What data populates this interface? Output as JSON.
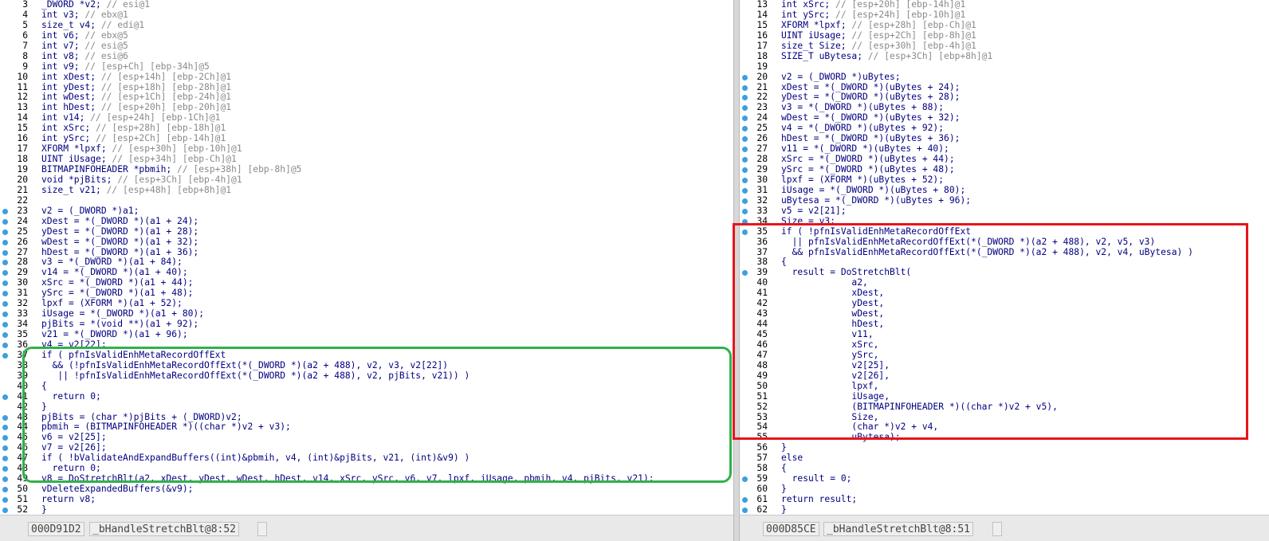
{
  "left_pane": {
    "status": {
      "address": "000D91D2",
      "function": "_bHandleStretchBlt@8:52"
    },
    "lines": [
      {
        "num": "3",
        "bp": false,
        "code": "_DWORD *v2; ",
        "comment": "// esi@1"
      },
      {
        "num": "4",
        "bp": false,
        "code": "int v3; ",
        "comment": "// ebx@1"
      },
      {
        "num": "5",
        "bp": false,
        "code": "size_t v4; ",
        "comment": "// edi@1"
      },
      {
        "num": "6",
        "bp": false,
        "code": "int v6; ",
        "comment": "// ebx@5"
      },
      {
        "num": "7",
        "bp": false,
        "code": "int v7; ",
        "comment": "// esi@5"
      },
      {
        "num": "8",
        "bp": false,
        "code": "int v8; ",
        "comment": "// esi@6"
      },
      {
        "num": "9",
        "bp": false,
        "code": "int v9; ",
        "comment": "// [esp+Ch] [ebp-34h]@5"
      },
      {
        "num": "10",
        "bp": false,
        "code": "int xDest; ",
        "comment": "// [esp+14h] [ebp-2Ch]@1"
      },
      {
        "num": "11",
        "bp": false,
        "code": "int yDest; ",
        "comment": "// [esp+18h] [ebp-28h]@1"
      },
      {
        "num": "12",
        "bp": false,
        "code": "int wDest; ",
        "comment": "// [esp+1Ch] [ebp-24h]@1"
      },
      {
        "num": "13",
        "bp": false,
        "code": "int hDest; ",
        "comment": "// [esp+20h] [ebp-20h]@1"
      },
      {
        "num": "14",
        "bp": false,
        "code": "int v14; ",
        "comment": "// [esp+24h] [ebp-1Ch]@1"
      },
      {
        "num": "15",
        "bp": false,
        "code": "int xSrc; ",
        "comment": "// [esp+28h] [ebp-18h]@1"
      },
      {
        "num": "16",
        "bp": false,
        "code": "int ySrc; ",
        "comment": "// [esp+2Ch] [ebp-14h]@1"
      },
      {
        "num": "17",
        "bp": false,
        "code": "XFORM *lpxf; ",
        "comment": "// [esp+30h] [ebp-10h]@1"
      },
      {
        "num": "18",
        "bp": false,
        "code": "UINT iUsage; ",
        "comment": "// [esp+34h] [ebp-Ch]@1"
      },
      {
        "num": "19",
        "bp": false,
        "code": "BITMAPINFOHEADER *pbmih; ",
        "comment": "// [esp+38h] [ebp-8h]@5"
      },
      {
        "num": "20",
        "bp": false,
        "code": "void *pjBits; ",
        "comment": "// [esp+3Ch] [ebp-4h]@1"
      },
      {
        "num": "21",
        "bp": false,
        "code": "size_t v21; ",
        "comment": "// [esp+48h] [ebp+8h]@1"
      },
      {
        "num": "22",
        "bp": false,
        "code": "",
        "comment": ""
      },
      {
        "num": "23",
        "bp": true,
        "code": "v2 = (_DWORD *)a1;",
        "comment": ""
      },
      {
        "num": "24",
        "bp": true,
        "code": "xDest = *(_DWORD *)(a1 + 24);",
        "comment": ""
      },
      {
        "num": "25",
        "bp": true,
        "code": "yDest = *(_DWORD *)(a1 + 28);",
        "comment": ""
      },
      {
        "num": "26",
        "bp": true,
        "code": "wDest = *(_DWORD *)(a1 + 32);",
        "comment": ""
      },
      {
        "num": "27",
        "bp": true,
        "code": "hDest = *(_DWORD *)(a1 + 36);",
        "comment": ""
      },
      {
        "num": "28",
        "bp": true,
        "code": "v3 = *(_DWORD *)(a1 + 84);",
        "comment": ""
      },
      {
        "num": "29",
        "bp": true,
        "code": "v14 = *(_DWORD *)(a1 + 40);",
        "comment": ""
      },
      {
        "num": "30",
        "bp": true,
        "code": "xSrc = *(_DWORD *)(a1 + 44);",
        "comment": ""
      },
      {
        "num": "31",
        "bp": true,
        "code": "ySrc = *(_DWORD *)(a1 + 48);",
        "comment": ""
      },
      {
        "num": "32",
        "bp": true,
        "code": "lpxf = (XFORM *)(a1 + 52);",
        "comment": ""
      },
      {
        "num": "33",
        "bp": true,
        "code": "iUsage = *(_DWORD *)(a1 + 80);",
        "comment": ""
      },
      {
        "num": "34",
        "bp": true,
        "code": "pjBits = *(void **)(a1 + 92);",
        "comment": ""
      },
      {
        "num": "35",
        "bp": true,
        "code": "v21 = *(_DWORD *)(a1 + 96);",
        "comment": ""
      },
      {
        "num": "36",
        "bp": true,
        "code": "v4 = v2[22];",
        "comment": ""
      },
      {
        "num": "37",
        "bp": true,
        "code": "if ( pfnIsValidEnhMetaRecordOffExt",
        "comment": ""
      },
      {
        "num": "38",
        "bp": false,
        "code": "  && (!pfnIsValidEnhMetaRecordOffExt(*(_DWORD *)(a2 + 488), v2, v3, v2[22])",
        "comment": ""
      },
      {
        "num": "39",
        "bp": false,
        "code": "   || !pfnIsValidEnhMetaRecordOffExt(*(_DWORD *)(a2 + 488), v2, pjBits, v21)) )",
        "comment": ""
      },
      {
        "num": "40",
        "bp": false,
        "code": "{",
        "comment": ""
      },
      {
        "num": "41",
        "bp": true,
        "code": "  return 0;",
        "comment": ""
      },
      {
        "num": "42",
        "bp": false,
        "code": "}",
        "comment": ""
      },
      {
        "num": "43",
        "bp": true,
        "code": "pjBits = (char *)pjBits + (_DWORD)v2;",
        "comment": ""
      },
      {
        "num": "44",
        "bp": true,
        "code": "pbmih = (BITMAPINFOHEADER *)((char *)v2 + v3);",
        "comment": ""
      },
      {
        "num": "45",
        "bp": true,
        "code": "v6 = v2[25];",
        "comment": ""
      },
      {
        "num": "46",
        "bp": true,
        "code": "v7 = v2[26];",
        "comment": ""
      },
      {
        "num": "47",
        "bp": true,
        "code": "if ( !bValidateAndExpandBuffers((int)&pbmih, v4, (int)&pjBits, v21, (int)&v9) )",
        "comment": ""
      },
      {
        "num": "48",
        "bp": true,
        "code": "  return 0;",
        "comment": ""
      },
      {
        "num": "49",
        "bp": true,
        "code": "v8 = DoStretchBlt(a2, xDest, yDest, wDest, hDest, v14, xSrc, ySrc, v6, v7, lpxf, iUsage, pbmih, v4, pjBits, v21);",
        "comment": ""
      },
      {
        "num": "50",
        "bp": true,
        "code": "vDeleteExpandedBuffers(&v9);",
        "comment": ""
      },
      {
        "num": "51",
        "bp": true,
        "code": "return v8;",
        "comment": ""
      },
      {
        "num": "52",
        "bp": true,
        "code": "}",
        "comment": ""
      }
    ]
  },
  "right_pane": {
    "status": {
      "address": "000D85CE",
      "function": "_bHandleStretchBlt@8:51"
    },
    "lines": [
      {
        "num": "13",
        "bp": false,
        "code": "int xSrc; ",
        "comment": "// [esp+20h] [ebp-14h]@1"
      },
      {
        "num": "14",
        "bp": false,
        "code": "int ySrc; ",
        "comment": "// [esp+24h] [ebp-10h]@1"
      },
      {
        "num": "15",
        "bp": false,
        "code": "XFORM *lpxf; ",
        "comment": "// [esp+28h] [ebp-Ch]@1"
      },
      {
        "num": "16",
        "bp": false,
        "code": "UINT iUsage; ",
        "comment": "// [esp+2Ch] [ebp-8h]@1"
      },
      {
        "num": "17",
        "bp": false,
        "code": "size_t Size; ",
        "comment": "// [esp+30h] [ebp-4h]@1"
      },
      {
        "num": "18",
        "bp": false,
        "code": "SIZE_T uBytesa; ",
        "comment": "// [esp+3Ch] [ebp+8h]@1"
      },
      {
        "num": "19",
        "bp": false,
        "code": "",
        "comment": ""
      },
      {
        "num": "20",
        "bp": true,
        "code": "v2 = (_DWORD *)uBytes;",
        "comment": ""
      },
      {
        "num": "21",
        "bp": true,
        "code": "xDest = *(_DWORD *)(uBytes + 24);",
        "comment": ""
      },
      {
        "num": "22",
        "bp": true,
        "code": "yDest = *(_DWORD *)(uBytes + 28);",
        "comment": ""
      },
      {
        "num": "23",
        "bp": true,
        "code": "v3 = *(_DWORD *)(uBytes + 88);",
        "comment": ""
      },
      {
        "num": "24",
        "bp": true,
        "code": "wDest = *(_DWORD *)(uBytes + 32);",
        "comment": ""
      },
      {
        "num": "25",
        "bp": true,
        "code": "v4 = *(_DWORD *)(uBytes + 92);",
        "comment": ""
      },
      {
        "num": "26",
        "bp": true,
        "code": "hDest = *(_DWORD *)(uBytes + 36);",
        "comment": ""
      },
      {
        "num": "27",
        "bp": true,
        "code": "v11 = *(_DWORD *)(uBytes + 40);",
        "comment": ""
      },
      {
        "num": "28",
        "bp": true,
        "code": "xSrc = *(_DWORD *)(uBytes + 44);",
        "comment": ""
      },
      {
        "num": "29",
        "bp": true,
        "code": "ySrc = *(_DWORD *)(uBytes + 48);",
        "comment": ""
      },
      {
        "num": "30",
        "bp": true,
        "code": "lpxf = (XFORM *)(uBytes + 52);",
        "comment": ""
      },
      {
        "num": "31",
        "bp": true,
        "code": "iUsage = *(_DWORD *)(uBytes + 80);",
        "comment": ""
      },
      {
        "num": "32",
        "bp": true,
        "code": "uBytesa = *(_DWORD *)(uBytes + 96);",
        "comment": ""
      },
      {
        "num": "33",
        "bp": true,
        "code": "v5 = v2[21];",
        "comment": ""
      },
      {
        "num": "34",
        "bp": true,
        "code": "Size = v3;",
        "comment": ""
      },
      {
        "num": "35",
        "bp": true,
        "code": "if ( !pfnIsValidEnhMetaRecordOffExt",
        "comment": ""
      },
      {
        "num": "36",
        "bp": false,
        "code": "  || pfnIsValidEnhMetaRecordOffExt(*(_DWORD *)(a2 + 488), v2, v5, v3)",
        "comment": ""
      },
      {
        "num": "37",
        "bp": false,
        "code": "  && pfnIsValidEnhMetaRecordOffExt(*(_DWORD *)(a2 + 488), v2, v4, uBytesa) )",
        "comment": ""
      },
      {
        "num": "38",
        "bp": false,
        "code": "{",
        "comment": ""
      },
      {
        "num": "39",
        "bp": true,
        "code": "  result = DoStretchBlt(",
        "comment": ""
      },
      {
        "num": "40",
        "bp": false,
        "code": "             a2,",
        "comment": ""
      },
      {
        "num": "41",
        "bp": false,
        "code": "             xDest,",
        "comment": ""
      },
      {
        "num": "42",
        "bp": false,
        "code": "             yDest,",
        "comment": ""
      },
      {
        "num": "43",
        "bp": false,
        "code": "             wDest,",
        "comment": ""
      },
      {
        "num": "44",
        "bp": false,
        "code": "             hDest,",
        "comment": ""
      },
      {
        "num": "45",
        "bp": false,
        "code": "             v11,",
        "comment": ""
      },
      {
        "num": "46",
        "bp": false,
        "code": "             xSrc,",
        "comment": ""
      },
      {
        "num": "47",
        "bp": false,
        "code": "             ySrc,",
        "comment": ""
      },
      {
        "num": "48",
        "bp": false,
        "code": "             v2[25],",
        "comment": ""
      },
      {
        "num": "49",
        "bp": false,
        "code": "             v2[26],",
        "comment": ""
      },
      {
        "num": "50",
        "bp": false,
        "code": "             lpxf,",
        "comment": ""
      },
      {
        "num": "51",
        "bp": false,
        "code": "             iUsage,",
        "comment": ""
      },
      {
        "num": "52",
        "bp": false,
        "code": "             (BITMAPINFOHEADER *)((char *)v2 + v5),",
        "comment": ""
      },
      {
        "num": "53",
        "bp": false,
        "code": "             Size,",
        "comment": ""
      },
      {
        "num": "54",
        "bp": false,
        "code": "             (char *)v2 + v4,",
        "comment": ""
      },
      {
        "num": "55",
        "bp": false,
        "code": "             uBytesa);",
        "comment": ""
      },
      {
        "num": "56",
        "bp": false,
        "code": "}",
        "comment": ""
      },
      {
        "num": "57",
        "bp": false,
        "code": "else",
        "comment": ""
      },
      {
        "num": "58",
        "bp": false,
        "code": "{",
        "comment": ""
      },
      {
        "num": "59",
        "bp": true,
        "code": "  result = 0;",
        "comment": ""
      },
      {
        "num": "60",
        "bp": false,
        "code": "}",
        "comment": ""
      },
      {
        "num": "61",
        "bp": true,
        "code": "return result;",
        "comment": ""
      },
      {
        "num": "62",
        "bp": true,
        "code": "}",
        "comment": ""
      }
    ]
  },
  "colors": {
    "code_text": "#000080",
    "comment_text": "#8a8a8a",
    "breakpoint_dot": "#3d9fe0",
    "left_highlight_box": "#2fb24a",
    "right_highlight_box": "#e8141b"
  }
}
